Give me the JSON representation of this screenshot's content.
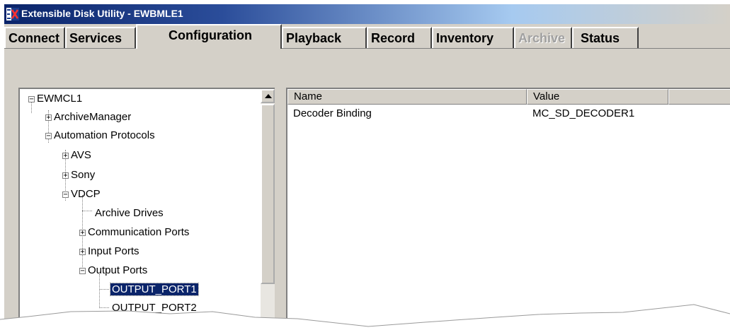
{
  "window": {
    "title": "Extensible Disk Utility - EWBMLE1",
    "icon": "ex-app-icon"
  },
  "tabs": [
    {
      "label": "Connect",
      "state": "normal"
    },
    {
      "label": "Services",
      "state": "normal"
    },
    {
      "label": "Configuration",
      "state": "active"
    },
    {
      "label": "Playback",
      "state": "normal"
    },
    {
      "label": "Record",
      "state": "normal"
    },
    {
      "label": "Inventory",
      "state": "normal"
    },
    {
      "label": "Archive",
      "state": "disabled"
    },
    {
      "label": "Status",
      "state": "normal"
    }
  ],
  "tree": {
    "items": [
      {
        "label": "EWMCL1",
        "expander": "-"
      },
      {
        "label": "ArchiveManager",
        "expander": "+"
      },
      {
        "label": "Automation Protocols",
        "expander": "-"
      },
      {
        "label": "AVS",
        "expander": "+"
      },
      {
        "label": "Sony",
        "expander": "+"
      },
      {
        "label": "VDCP",
        "expander": "-"
      },
      {
        "label": "Archive Drives",
        "expander": ""
      },
      {
        "label": "Communication Ports",
        "expander": "+"
      },
      {
        "label": "Input Ports",
        "expander": "+"
      },
      {
        "label": "Output Ports",
        "expander": "-"
      },
      {
        "label": "OUTPUT_PORT1",
        "expander": "",
        "selected": true
      },
      {
        "label": "OUTPUT_PORT2",
        "expander": ""
      }
    ]
  },
  "list": {
    "columns": [
      "Name",
      "Value",
      ""
    ],
    "rows": [
      {
        "name": "Decoder Binding",
        "value": "MC_SD_DECODER1"
      }
    ]
  },
  "colors": {
    "titlebar_start": "#0a246a",
    "face": "#d4d0c8",
    "selection": "#0a246a"
  }
}
